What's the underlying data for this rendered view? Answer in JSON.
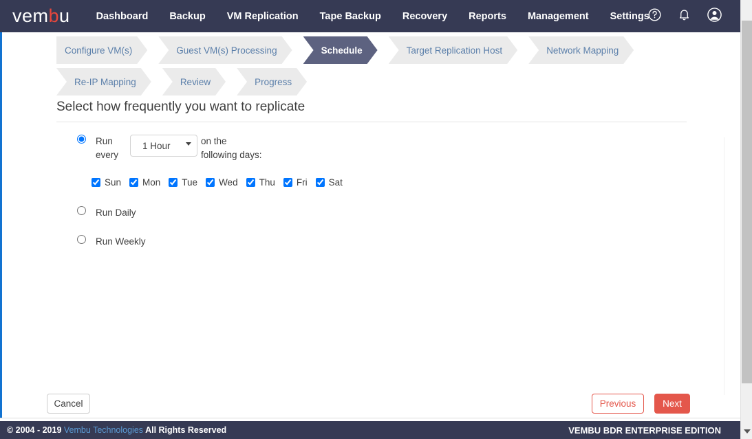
{
  "brand": {
    "logo_text_1": "vem",
    "logo_text_2": "b",
    "logo_text_3": "u",
    "accent_color": "#e8473c",
    "header_color": "#363a54"
  },
  "topnav": {
    "items": [
      {
        "label": "Dashboard"
      },
      {
        "label": "Backup"
      },
      {
        "label": "VM Replication"
      },
      {
        "label": "Tape Backup"
      },
      {
        "label": "Recovery"
      },
      {
        "label": "Reports"
      },
      {
        "label": "Management"
      },
      {
        "label": "Settings"
      }
    ],
    "icons": [
      {
        "name": "help-icon"
      },
      {
        "name": "notification-bell-icon"
      },
      {
        "name": "user-account-icon"
      }
    ]
  },
  "wizard": {
    "row1": [
      {
        "label": "Configure VM(s)",
        "active": false
      },
      {
        "label": "Guest VM(s) Processing",
        "active": false
      },
      {
        "label": "Schedule",
        "active": true
      },
      {
        "label": "Target Replication Host",
        "active": false
      },
      {
        "label": "Network Mapping",
        "active": false
      }
    ],
    "row2": [
      {
        "label": "Re-IP Mapping",
        "active": false
      },
      {
        "label": "Review",
        "active": false
      },
      {
        "label": "Progress",
        "active": false
      }
    ],
    "active_color": "#5d6280",
    "inactive_color": "#ebebeb",
    "inactive_text_color": "#5b7faa"
  },
  "main": {
    "title": "Select how frequently you want to replicate",
    "options": {
      "hourly": {
        "label_line1": "Run",
        "label_line2": "every",
        "selected": true,
        "select_value": "1 Hour",
        "select_options": [
          "1 Hour"
        ],
        "suffix_text": "on the following days:"
      },
      "daily": {
        "label": "Run Daily",
        "selected": false
      },
      "weekly": {
        "label": "Run Weekly",
        "selected": false
      }
    },
    "days": [
      {
        "label": "Sun",
        "checked": true
      },
      {
        "label": "Mon",
        "checked": true
      },
      {
        "label": "Tue",
        "checked": true
      },
      {
        "label": "Wed",
        "checked": true
      },
      {
        "label": "Thu",
        "checked": true
      },
      {
        "label": "Fri",
        "checked": true
      },
      {
        "label": "Sat",
        "checked": true
      }
    ]
  },
  "actions": {
    "cancel_label": "Cancel",
    "previous_label": "Previous",
    "next_label": "Next",
    "next_color": "#e4574b"
  },
  "footer": {
    "copyright": "© 2004 - 2019",
    "company": "Vembu Technologies",
    "rights": "All Rights Reserved",
    "edition": "VEMBU BDR ENTERPRISE EDITION"
  },
  "scrollbar": {
    "down_arrow_name": "scroll-down-arrow"
  }
}
